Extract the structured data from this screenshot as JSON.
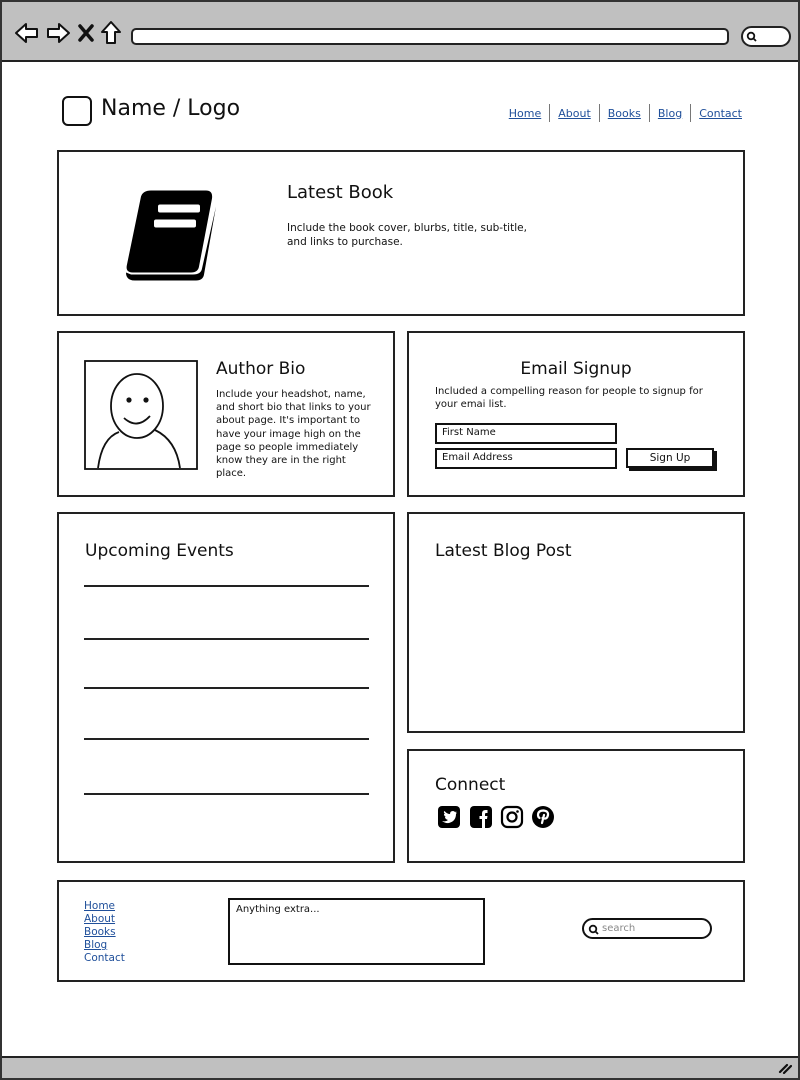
{
  "browser": {
    "back_icon": "back-arrow-icon",
    "forward_icon": "forward-arrow-icon",
    "stop_icon": "stop-x-icon",
    "home_icon": "home-icon",
    "url": "",
    "search_icon": "search-icon",
    "resize_icon": "resize-grip-icon"
  },
  "header": {
    "logo_text": "Name / Logo",
    "nav": [
      "Home",
      "About",
      "Books",
      "Blog",
      "Contact"
    ]
  },
  "latest_book": {
    "title": "Latest Book",
    "description": "Include the book cover, blurbs, title, sub-title, and links to purchase.",
    "icon": "book-icon"
  },
  "author_bio": {
    "title": "Author Bio",
    "description": "Include your headshot, name, and short bio that links to your about page. It's important to have your image high on the page so people immediately know they are in the right place.",
    "icon": "headshot-placeholder-icon"
  },
  "email_signup": {
    "title": "Email Signup",
    "description": "Included a compelling reason for people to signup for your emai list.",
    "first_name_placeholder": "First Name",
    "email_placeholder": "Email Address",
    "button_label": "Sign Up"
  },
  "upcoming_events": {
    "title": "Upcoming Events",
    "rows": 5
  },
  "latest_blog": {
    "title": "Latest Blog Post"
  },
  "connect": {
    "title": "Connect",
    "icons": [
      "twitter-icon",
      "facebook-icon",
      "instagram-icon",
      "pinterest-icon"
    ]
  },
  "footer": {
    "links": [
      "Home",
      "About",
      "Books",
      "Blog",
      "Contact"
    ],
    "extra_text": "Anything extra...",
    "search_placeholder": "search"
  }
}
